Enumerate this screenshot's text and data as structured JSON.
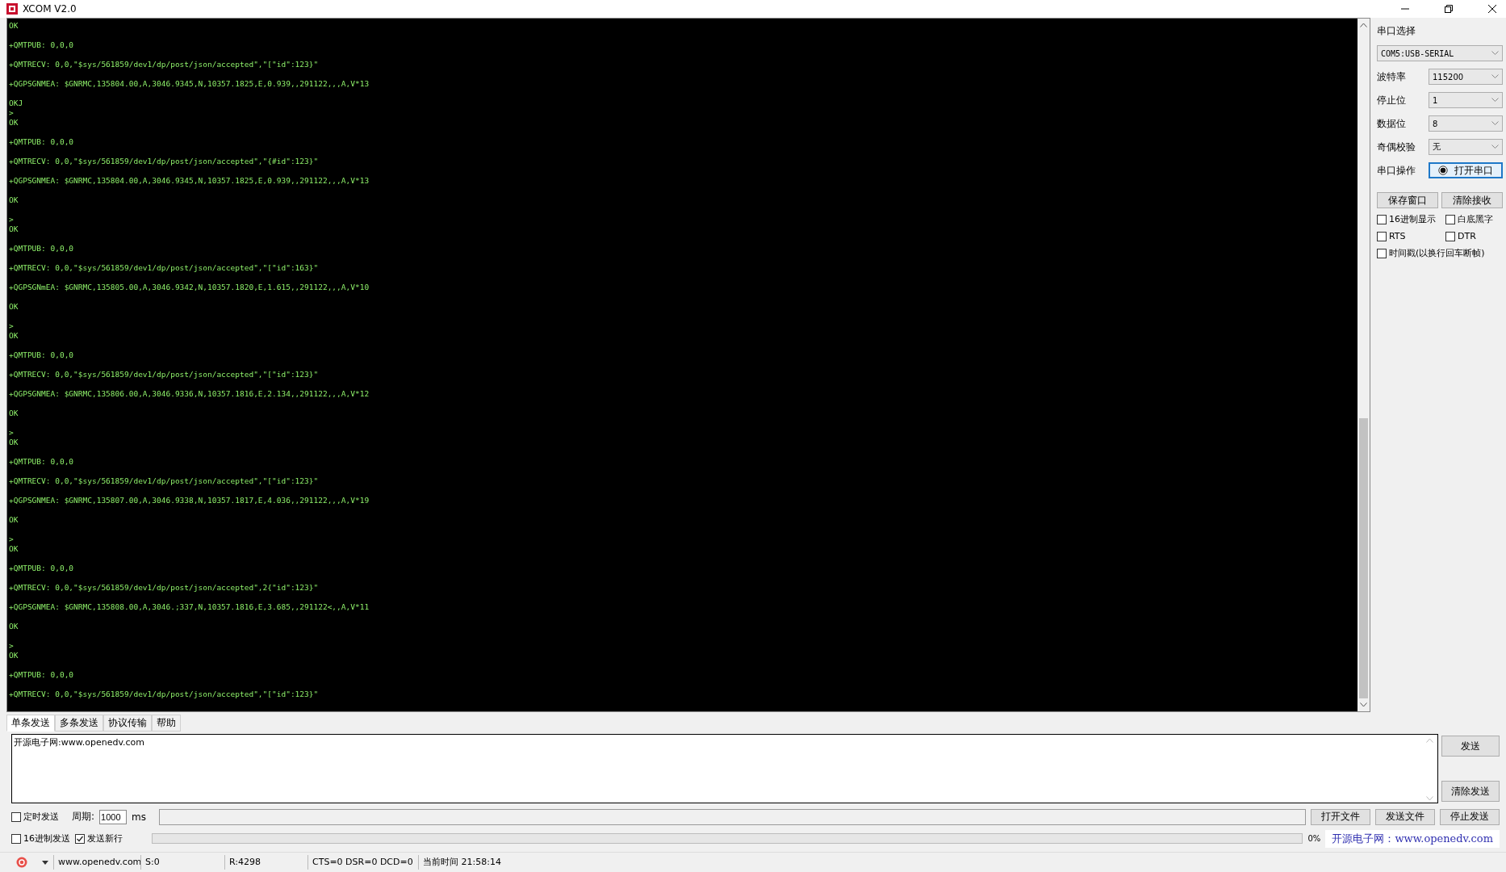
{
  "window": {
    "title": "XCOM V2.0"
  },
  "receive_area": {
    "text": "OK\n\n+QMTPUB: 0,0,0\n\n+QMTRECV: 0,0,\"$sys/561859/dev1/dp/post/json/accepted\",\"[\"id\":123}\"\n\n+QGPSGNMEA: $GNRMC,135804.00,A,3046.9345,N,10357.1825,E,0.939,,291122,,,A,V*13\n\nOKJ\n>\nOK\n\n+QMTPUB: 0,0,0\n\n+QMTRECV: 0,0,\"$sys/561859/dev1/dp/post/json/accepted\",\"{#id\":123}\"\n\n+QGPSGNMEA: $GNRMC,135804.00,A,3046.9345,N,10357.1825,E,0.939,,291122,,,A,V*13\n\nOK\n\n>\nOK\n\n+QMTPUB: 0,0,0\n\n+QMTRECV: 0,0,\"$sys/561859/dev1/dp/post/json/accepted\",\"[\"id\":163}\"\n\n+QGPSGNmEA: $GNRMC,135805.00,A,3046.9342,N,10357.1820,E,1.615,,291122,,,A,V*10\n\nOK\n\n>\nOK\n\n+QMTPUB: 0,0,0\n\n+QMTRECV: 0,0,\"$sys/561859/dev1/dp/post/json/accepted\",\"[\"id\":123}\"\n\n+QGPSGNMEA: $GNRMC,135806.00,A,3046.9336,N,10357.1816,E,2.134,,291122,,,A,V*12\n\nOK\n\n>\nOK\n\n+QMTPUB: 0,0,0\n\n+QMTRECV: 0,0,\"$sys/561859/dev1/dp/post/json/accepted\",\"[\"id\":123}\"\n\n+QGPSGNMEA: $GNRMC,135807.00,A,3046.9338,N,10357.1817,E,4.036,,291122,,,A,V*19\n\nOK\n\n>\nOK\n\n+QMTPUB: 0,0,0\n\n+QMTRECV: 0,0,\"$sys/561859/dev1/dp/post/json/accepted\",2{\"id\":123}\"\n\n+QGPSGNMEA: $GNRMC,135808.00,A,3046.;337,N,10357.1816,E,3.685,,291122<,,A,V*11\n\nOK\n\n>\nOK\n\n+QMTPUB: 0,0,0\n\n+QMTRECV: 0,0,\"$sys/561859/dev1/dp/post/json/accepted\",\"[\"id\":123}\""
  },
  "serial_panel": {
    "port_label": "串口选择",
    "port": "COM5:USB-SERIAL",
    "settings": [
      {
        "label": "波特率",
        "value": "115200"
      },
      {
        "label": "停止位",
        "value": "1"
      },
      {
        "label": "数据位",
        "value": "8"
      },
      {
        "label": "奇偶校验",
        "value": "无"
      }
    ],
    "operation_label": "串口操作",
    "open_button": "打开串口",
    "buttons": [
      "保存窗口",
      "清除接收"
    ],
    "options": [
      {
        "label": "16进制显示",
        "checked": false
      },
      {
        "label": "白底黑字",
        "checked": false
      },
      {
        "label": "RTS",
        "checked": false
      },
      {
        "label": "DTR",
        "checked": false
      },
      {
        "label": "时间戳(以换行回车断帧)",
        "checked": false
      }
    ]
  },
  "send_tabs": [
    {
      "label": "单条发送",
      "selected": true
    },
    {
      "label": "多条发送",
      "selected": false
    },
    {
      "label": "协议传输",
      "selected": false
    },
    {
      "label": "帮助",
      "selected": false
    }
  ],
  "send_text": "开源电子网:www.openedv.com",
  "send_buttons": [
    "发送",
    "清除发送"
  ],
  "timed_send": {
    "label": "定时发送",
    "checked": false
  },
  "period_label": "周期:",
  "period": "1000",
  "period_unit": "ms",
  "file_buttons": [
    "打开文件",
    "发送文件",
    "停止发送"
  ],
  "send_options": [
    {
      "label": "16进制发送",
      "checked": false
    },
    {
      "label": "发送新行",
      "checked": true
    }
  ],
  "progress": {
    "level": 0,
    "reading": "0%"
  },
  "site_link": "开源电子网：www.openedv.com",
  "status_bar": {
    "url": "www.openedv.com",
    "sent": "S:0",
    "received": "R:4298",
    "lines": "CTS=0 DSR=0 DCD=0",
    "time": "当前时间 21:58:14"
  }
}
